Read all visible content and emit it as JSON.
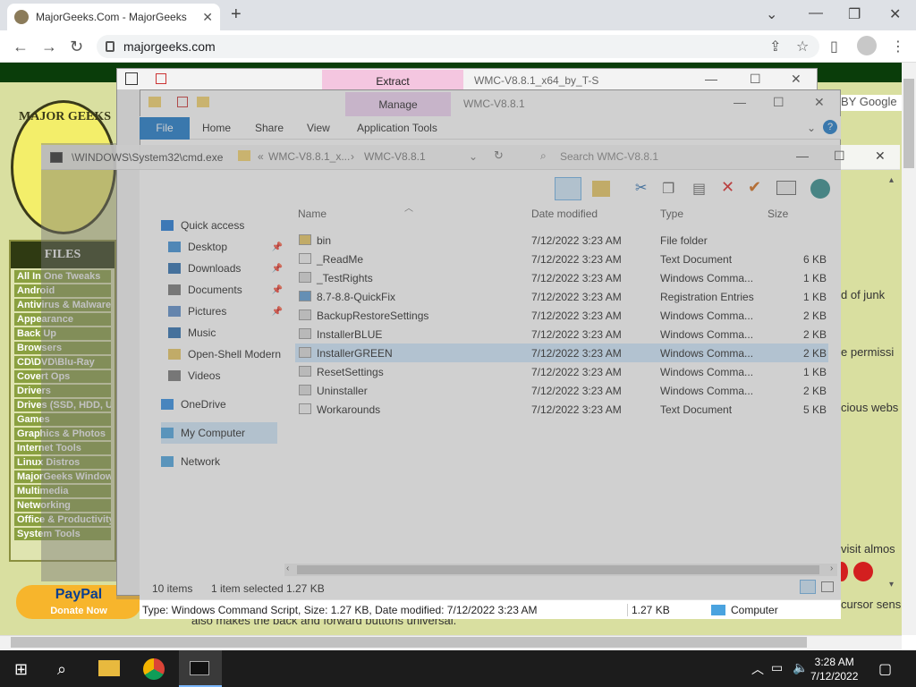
{
  "browser": {
    "tab_title": "MajorGeeks.Com - MajorGeeks",
    "url": "majorgeeks.com"
  },
  "website": {
    "sidebar_header": "FILES",
    "logo_text": "MAJOR GEEKS",
    "sidebar_items": [
      "All In One Tweaks",
      "Android",
      "Antivirus & Malware",
      "Appearance",
      "Back Up",
      "Browsers",
      "CD\\DVD\\Blu-Ray",
      "Covert Ops",
      "Drivers",
      "Drives (SSD, HDD, USB)",
      "Games",
      "Graphics & Photos",
      "Internet Tools",
      "Linux Distros",
      "MajorGeeks Windows Tweaks",
      "Multimedia",
      "Networking",
      "Office & Productivity",
      "System Tools"
    ],
    "paypal": "PayPal",
    "paypal_sub": "Donate Now",
    "fragments": [
      "d of junk",
      "e permissi",
      "cious webs",
      "visit almos",
      "cursor sens",
      "also makes the back and forward buttons universal."
    ],
    "google": "BY Google"
  },
  "explorer_back": {
    "tab": "Extract",
    "title": "WMC-V8.8.1_x64_by_T-S",
    "cmd_title": "\\WINDOWS\\System32\\cmd.exe"
  },
  "explorer": {
    "manage_tab": "Manage",
    "title": "WMC-V8.8.1",
    "tabs": [
      "File",
      "Home",
      "Share",
      "View",
      "Application Tools"
    ],
    "breadcrumb": [
      "WMC-V8.8.1_x...",
      "WMC-V8.8.1"
    ],
    "search_placeholder": "Search WMC-V8.8.1",
    "nav": [
      {
        "label": "Quick access",
        "pinned": false
      },
      {
        "label": "Desktop",
        "pinned": true
      },
      {
        "label": "Downloads",
        "pinned": true
      },
      {
        "label": "Documents",
        "pinned": true
      },
      {
        "label": "Pictures",
        "pinned": true
      },
      {
        "label": "Music",
        "pinned": false
      },
      {
        "label": "Open-Shell Modern",
        "pinned": false
      },
      {
        "label": "Videos",
        "pinned": false
      },
      {
        "label": "OneDrive",
        "pinned": false
      },
      {
        "label": "My Computer",
        "pinned": false
      },
      {
        "label": "Network",
        "pinned": false
      }
    ],
    "columns": [
      "Name",
      "Date modified",
      "Type",
      "Size"
    ],
    "files": [
      {
        "name": "bin",
        "date": "7/12/2022 3:23 AM",
        "type": "File folder",
        "size": ""
      },
      {
        "name": "_ReadMe",
        "date": "7/12/2022 3:23 AM",
        "type": "Text Document",
        "size": "6 KB"
      },
      {
        "name": "_TestRights",
        "date": "7/12/2022 3:23 AM",
        "type": "Windows Comma...",
        "size": "1 KB"
      },
      {
        "name": "8.7-8.8-QuickFix",
        "date": "7/12/2022 3:23 AM",
        "type": "Registration Entries",
        "size": "1 KB"
      },
      {
        "name": "BackupRestoreSettings",
        "date": "7/12/2022 3:23 AM",
        "type": "Windows Comma...",
        "size": "2 KB"
      },
      {
        "name": "InstallerBLUE",
        "date": "7/12/2022 3:23 AM",
        "type": "Windows Comma...",
        "size": "2 KB"
      },
      {
        "name": "InstallerGREEN",
        "date": "7/12/2022 3:23 AM",
        "type": "Windows Comma...",
        "size": "2 KB"
      },
      {
        "name": "ResetSettings",
        "date": "7/12/2022 3:23 AM",
        "type": "Windows Comma...",
        "size": "1 KB"
      },
      {
        "name": "Uninstaller",
        "date": "7/12/2022 3:23 AM",
        "type": "Windows Comma...",
        "size": "2 KB"
      },
      {
        "name": "Workarounds",
        "date": "7/12/2022 3:23 AM",
        "type": "Text Document",
        "size": "5 KB"
      }
    ],
    "selected_index": 6,
    "item_count": "10 items",
    "selected_text": "1 item selected",
    "selected_size": "1.27 KB",
    "status_text": "Type: Windows Command Script, Size: 1.27 KB, Date modified: 7/12/2022 3:23 AM",
    "status_size": "1.27 KB",
    "status_location": "Computer"
  },
  "taskbar": {
    "time": "3:28 AM",
    "date": "7/12/2022"
  }
}
